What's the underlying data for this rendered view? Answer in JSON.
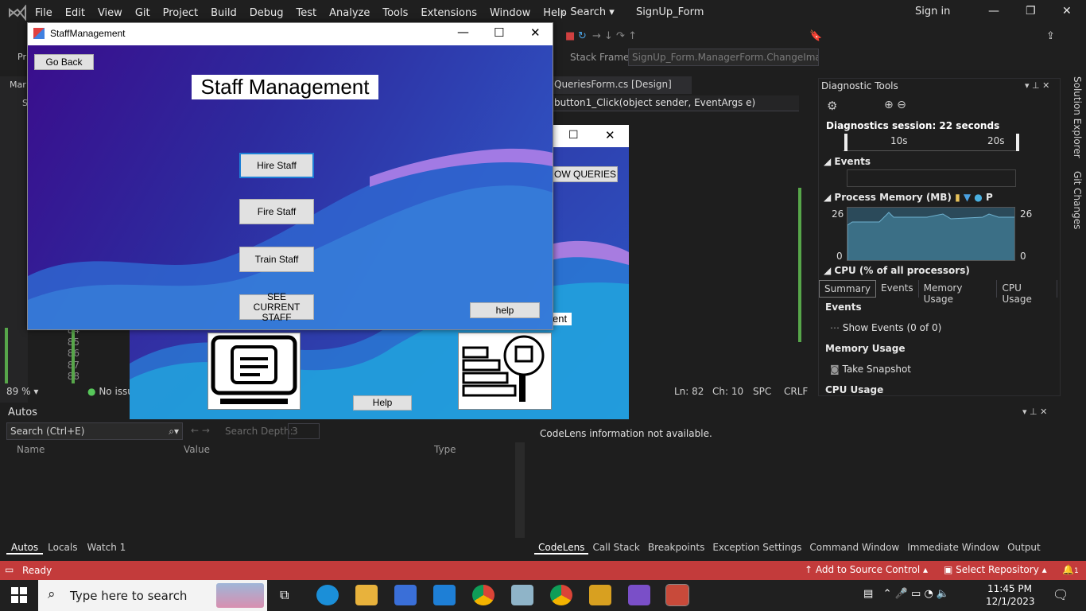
{
  "vs": {
    "menu": [
      "File",
      "Edit",
      "View",
      "Git",
      "Project",
      "Build",
      "Debug",
      "Test",
      "Analyze",
      "Tools",
      "Extensions",
      "Window",
      "Help"
    ],
    "search_label": "Search",
    "solution_name": "SignUp_Form",
    "signin": "Sign in",
    "stack_frame_label": "Stack Frame:",
    "stack_frame_value": "SignUp_Form.ManagerForm.ChangeImag",
    "editor_tab": "QueriesForm.cs [Design]",
    "editor_method": "button1_Click(object sender, EventArgs e)",
    "editor_status": {
      "ln": "Ln: 82",
      "ch": "Ch: 10",
      "spc": "SPC",
      "crlf": "CRLF"
    },
    "line_numbers": [
      "84",
      "85",
      "86",
      "87",
      "88"
    ],
    "zoom": "89 %",
    "issues": "No issu",
    "left_tab_fragments": [
      "Mar",
      "Pr",
      "S"
    ]
  },
  "diagnostics": {
    "title": "Diagnostic Tools",
    "session": "Diagnostics session: 22 seconds",
    "timeline_labels": [
      "10s",
      "20s"
    ],
    "events_label": "Events",
    "memory_label": "Process Memory (MB)",
    "memory_legend_p": "P",
    "mem_max_left": "26",
    "mem_min_left": "0",
    "mem_max_right": "26",
    "mem_min_right": "0",
    "cpu_label": "CPU (% of all processors)",
    "tabs": [
      "Summary",
      "Events",
      "Memory Usage",
      "CPU Usage"
    ],
    "events_head": "Events",
    "show_events": "Show Events (0 of 0)",
    "memory_usage_head": "Memory Usage",
    "take_snapshot": "Take Snapshot",
    "cpu_usage_head": "CPU Usage",
    "side_tabs": [
      "Solution Explorer",
      "Git Changes"
    ]
  },
  "autos": {
    "title": "Autos",
    "search_placeholder": "Search (Ctrl+E)",
    "depth_label": "Search Depth:",
    "depth_value": "3",
    "columns": [
      "Name",
      "Value",
      "Type"
    ],
    "tabs": [
      "Autos",
      "Locals",
      "Watch 1"
    ]
  },
  "codelens": {
    "message": "CodeLens information not available.",
    "tabs": [
      "CodeLens",
      "Call Stack",
      "Breakpoints",
      "Exception Settings",
      "Command Window",
      "Immediate Window",
      "Output"
    ]
  },
  "statusbar": {
    "ready": "Ready",
    "source_control": "Add to Source Control",
    "repository": "Select Repository",
    "notifications": "1"
  },
  "taskbar": {
    "search_placeholder": "Type here to search",
    "time": "11:45 PM",
    "date": "12/1/2023"
  },
  "queries_form": {
    "show_queries_button": "OW QUERIES",
    "partial_label": "ent",
    "help_button": "Help"
  },
  "staff_form": {
    "window_title": "StaffManagement",
    "go_back": "Go Back",
    "heading": "Staff Management",
    "buttons": [
      "Hire Staff",
      "Fire Staff",
      "Train Staff",
      "SEE CURRENT STAFF"
    ],
    "help": "help"
  }
}
